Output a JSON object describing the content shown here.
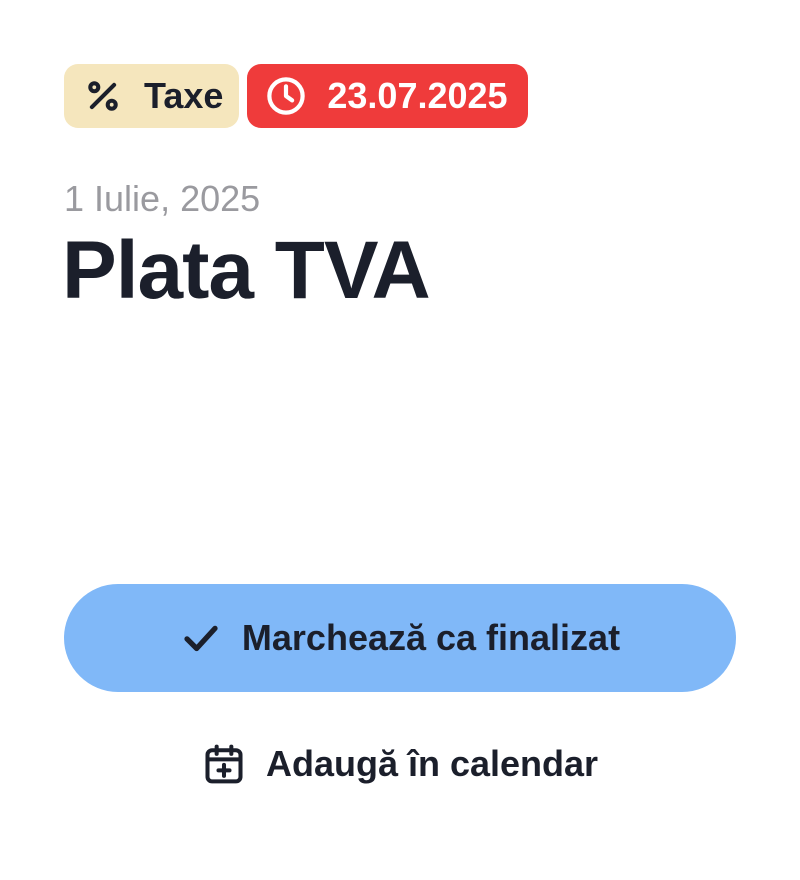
{
  "badges": {
    "category": {
      "label": "Taxe",
      "icon": "percent-icon",
      "color": "#f5e6bd"
    },
    "deadline": {
      "label": "23.07.2025",
      "icon": "clock-icon",
      "color": "#ef3b3b"
    }
  },
  "task": {
    "date": "1 Iulie, 2025",
    "title": "Plata TVA"
  },
  "actions": {
    "complete": {
      "label": "Marchează ca finalizat",
      "icon": "check-icon",
      "color": "#80b8f8"
    },
    "calendar": {
      "label": "Adaugă în calendar",
      "icon": "calendar-plus-icon"
    }
  }
}
